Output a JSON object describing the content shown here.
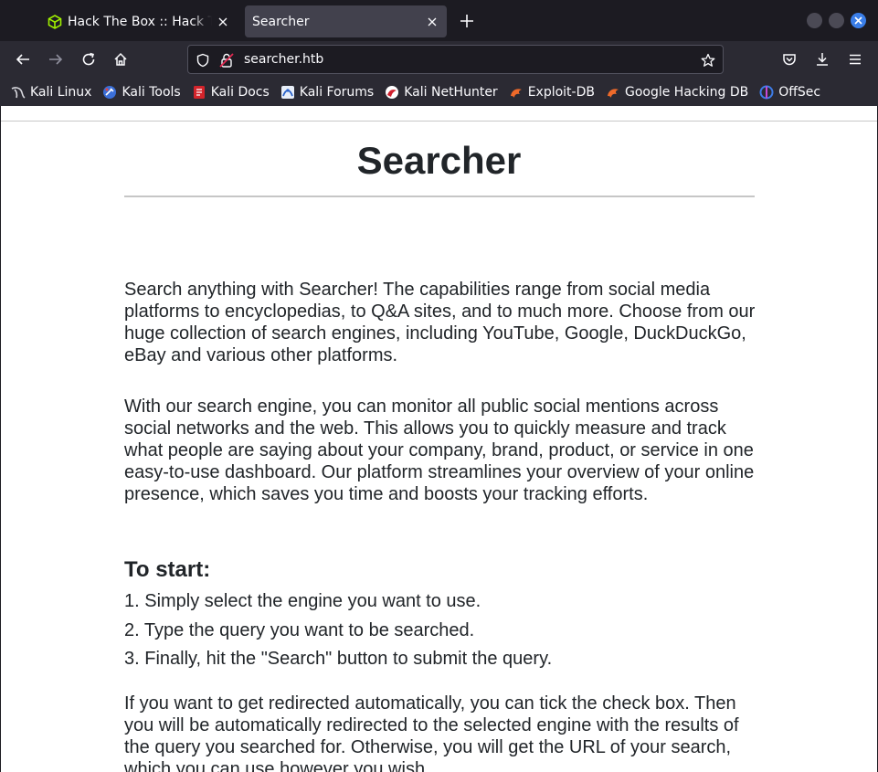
{
  "browser": {
    "tabs": [
      {
        "label": "Hack The Box :: Hack The Box",
        "icon": "htb-cube-icon"
      },
      {
        "label": "Searcher",
        "icon": "none"
      }
    ],
    "url": "searcher.htb",
    "bookmarks": [
      {
        "label": "Kali Linux",
        "icon": "kali-dragon-icon"
      },
      {
        "label": "Kali Tools",
        "icon": "kali-tools-icon"
      },
      {
        "label": "Kali Docs",
        "icon": "kali-docs-icon"
      },
      {
        "label": "Kali Forums",
        "icon": "kali-forums-icon"
      },
      {
        "label": "Kali NetHunter",
        "icon": "nethunter-icon"
      },
      {
        "label": "Exploit-DB",
        "icon": "exploit-db-icon"
      },
      {
        "label": "Google Hacking DB",
        "icon": "ghdb-icon"
      },
      {
        "label": "OffSec",
        "icon": "offsec-icon"
      }
    ],
    "colors": {
      "tabstrip": "#1c1b22",
      "toolbar": "#2b2a33",
      "active_tab": "#42414d",
      "close_accent": "#3a7ee8"
    }
  },
  "page": {
    "title": "Searcher",
    "intro": "Search anything with Searcher! The capabilities range from social media platforms to encyclopedias, to Q&A sites, and to much more. Choose from our huge collection of search engines, including YouTube, Google, DuckDuckGo, eBay and various other platforms.",
    "monitor": "With our search engine, you can monitor all public social mentions across social networks and the web. This allows you to quickly measure and track what people are saying about your company, brand, product, or service in one easy-to-use dashboard. Our platform streamlines your overview of your online presence, which saves you time and boosts your tracking efforts.",
    "start_heading": "To start:",
    "steps": [
      "1. Simply select the engine you want to use.",
      "2. Type the query you want to be searched.",
      "3. Finally, hit the \"Search\" button to submit the query."
    ],
    "redirect_text": "If you want to get redirected automatically, you can tick the check box. Then you will be automatically redirected to the selected engine with the results of the query you searched for. Otherwise, you will get the URL of your search, which you can use however you wish."
  }
}
